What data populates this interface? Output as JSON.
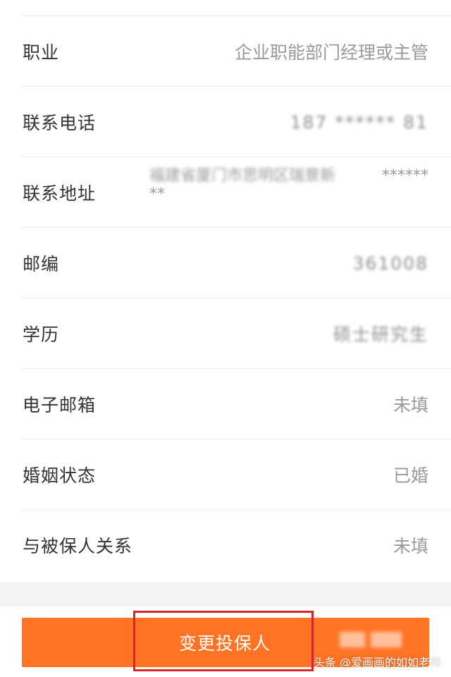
{
  "rows": [
    {
      "label": "职业",
      "value": "企业职能部门经理或主管"
    },
    {
      "label": "联系电话",
      "value": "187 ****** 81"
    },
    {
      "label": "联系地址",
      "value_line1": "福建省厦门市思明区瑞景新",
      "value_stars": "******",
      "value_line2": "**"
    },
    {
      "label": "邮编",
      "value": "361008"
    },
    {
      "label": "学历",
      "value": "硕士研究生"
    },
    {
      "label": "电子邮箱",
      "value": "未填"
    },
    {
      "label": "婚姻状态",
      "value": "已婚"
    },
    {
      "label": "与被保人关系",
      "value": "未填"
    }
  ],
  "action": {
    "label": "变更投保人"
  },
  "watermark": "头条 @爱画画的如如老师",
  "colors": {
    "accent": "#ff7424",
    "highlight": "#d8242a"
  }
}
